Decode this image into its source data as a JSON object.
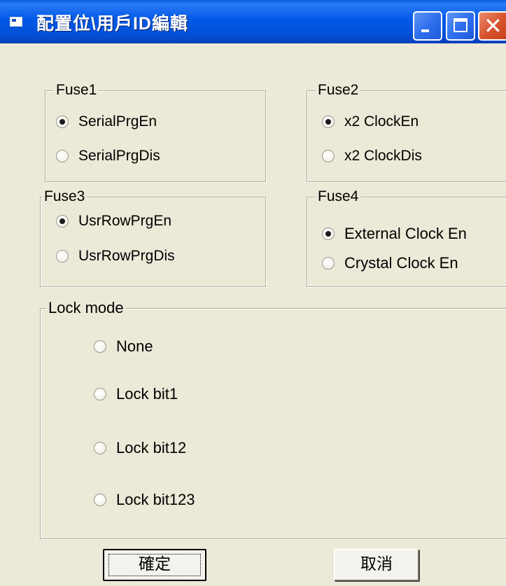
{
  "window": {
    "title": "配置位\\用戶ID編輯"
  },
  "fuse1": {
    "label": "Fuse1",
    "options": [
      "SerialPrgEn",
      "SerialPrgDis"
    ],
    "selected": "SerialPrgEn"
  },
  "fuse2": {
    "label": "Fuse2",
    "options": [
      "x2 ClockEn",
      "x2 ClockDis"
    ],
    "selected": "x2 ClockEn"
  },
  "fuse3": {
    "label": "Fuse3",
    "options": [
      "UsrRowPrgEn",
      "UsrRowPrgDis"
    ],
    "selected": "UsrRowPrgEn"
  },
  "fuse4": {
    "label": "Fuse4",
    "options": [
      "External Clock En",
      "Crystal Clock En"
    ],
    "selected": "External Clock En"
  },
  "lock_mode": {
    "label": "Lock mode",
    "options": [
      "None",
      "Lock bit1",
      "Lock bit12",
      "Lock bit123"
    ],
    "selected": null
  },
  "buttons": {
    "ok_label": "確定",
    "cancel_label": "取消"
  }
}
